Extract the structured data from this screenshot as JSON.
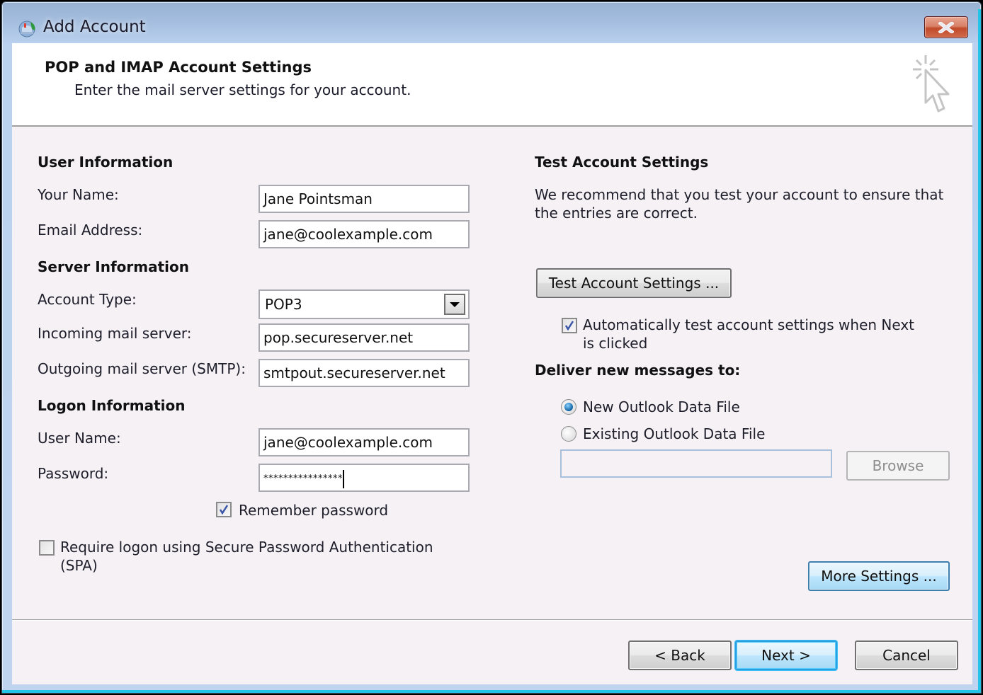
{
  "window": {
    "title": "Add Account",
    "close_label": "Close"
  },
  "header": {
    "title": "POP and IMAP Account Settings",
    "subtitle": "Enter the mail server settings for your account."
  },
  "user_information": {
    "heading": "User Information",
    "your_name": {
      "label": "Your Name:",
      "value": "Jane Pointsman"
    },
    "email_address": {
      "label": "Email Address:",
      "value": "jane@coolexample.com"
    }
  },
  "server_information": {
    "heading": "Server Information",
    "account_type": {
      "label": "Account Type:",
      "value": "POP3"
    },
    "incoming_server": {
      "label": "Incoming mail server:",
      "value": "pop.secureserver.net"
    },
    "outgoing_server": {
      "label": "Outgoing mail server (SMTP):",
      "value": "smtpout.secureserver.net"
    }
  },
  "logon_information": {
    "heading": "Logon Information",
    "user_name": {
      "label": "User Name:",
      "value": "jane@coolexample.com"
    },
    "password": {
      "label": "Password:",
      "value": "****************"
    },
    "remember_password": {
      "label": "Remember password",
      "checked": true
    },
    "require_spa": {
      "label_line1": "Require logon using Secure Password Authentication",
      "label_line2": "(SPA)",
      "checked": false
    }
  },
  "test_account": {
    "heading": "Test Account Settings",
    "description_line1": "We recommend that you test your account to ensure that",
    "description_line2": "the entries are correct.",
    "test_button": "Test Account Settings ...",
    "auto_test": {
      "label_line1": "Automatically test account settings when Next",
      "label_line2": "is clicked",
      "checked": true
    }
  },
  "deliver": {
    "heading": "Deliver new messages to:",
    "options": [
      {
        "label": "New Outlook Data File",
        "selected": true
      },
      {
        "label": "Existing Outlook Data File",
        "selected": false
      }
    ],
    "file_path": "",
    "browse_button": "Browse"
  },
  "more_settings_button": "More Settings ...",
  "footer": {
    "back": "< Back",
    "next": "Next >",
    "cancel": "Cancel"
  },
  "colors": {
    "accent_blue": "#3c7fb1",
    "focus_cyan": "#22c4e8",
    "close_red": "#c04a2a",
    "dialog_bg": "#f5f1f5"
  }
}
